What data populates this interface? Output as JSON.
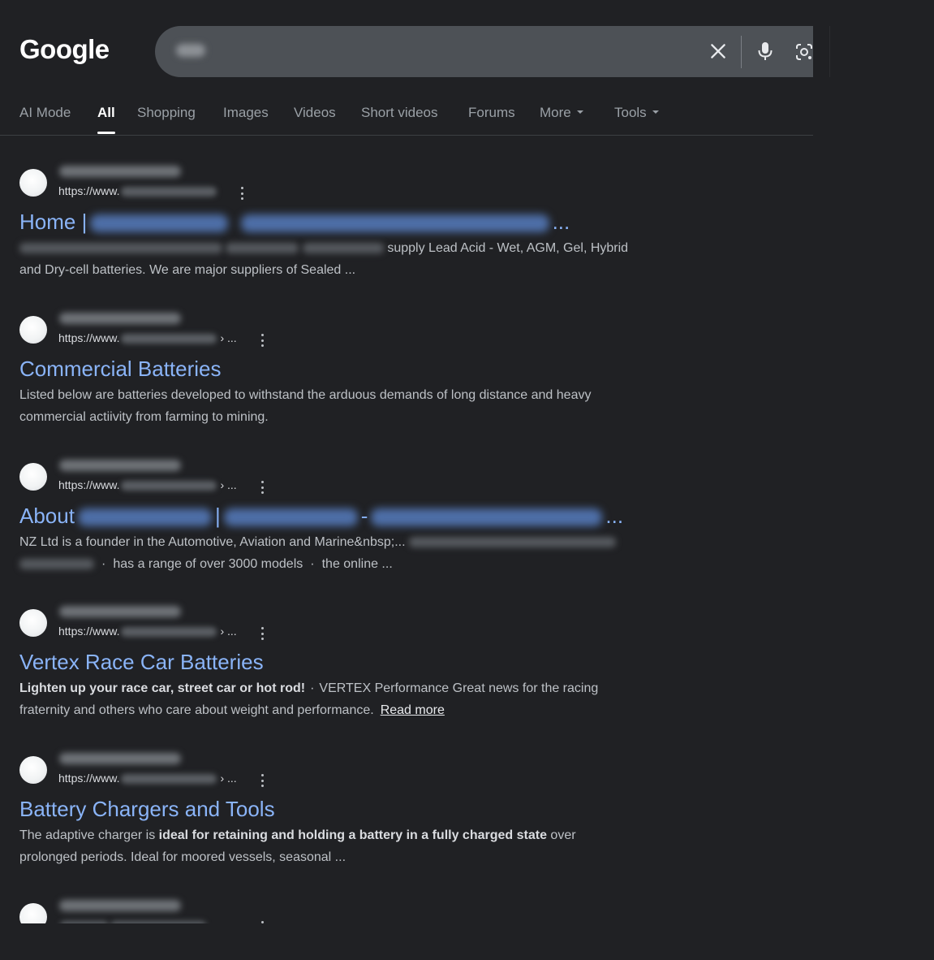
{
  "header": {
    "logo_text": "Google",
    "icons": {
      "clear": "close-icon",
      "voice": "mic-icon",
      "lens": "camera-lens-icon"
    }
  },
  "tabs": [
    {
      "label": "AI Mode"
    },
    {
      "label": "All",
      "active": true
    },
    {
      "label": "Shopping"
    },
    {
      "label": "Images"
    },
    {
      "label": "Videos"
    },
    {
      "label": "Short videos"
    },
    {
      "label": "Forums"
    },
    {
      "label": "More",
      "dropdown": true
    },
    {
      "label": "Tools",
      "dropdown": true
    }
  ],
  "results": [
    {
      "url_prefix": "https://www.",
      "url_tail": "",
      "title_start": "Home |",
      "title_end": "...",
      "snippet_line1": "supply Lead Acid - Wet, AGM, Gel, Hybrid",
      "snippet_line2": "and Dry-cell batteries. We are major suppliers of Sealed ..."
    },
    {
      "url_prefix": "https://www.",
      "url_tail": "› ...",
      "title": "Commercial Batteries",
      "snippet_line1": "Listed below are batteries developed to withstand the arduous demands of long distance and heavy",
      "snippet_line2": "commercial actiivity from farming to mining."
    },
    {
      "url_prefix": "https://www.",
      "url_tail": "› ...",
      "title_start": "About",
      "title_mid": "|",
      "title_dash": "-",
      "title_end": "...",
      "snippet_line1": "NZ Ltd is a founder in the Automotive, Aviation and Marine&nbsp;...",
      "snippet_part2": "has a range of over 3000 models",
      "snippet_part3": "the online ...",
      "separator": "·"
    },
    {
      "url_prefix": "https://www.",
      "url_tail": "› ...",
      "title": "Vertex Race Car Batteries",
      "snippet_bold": "Lighten up your race car, street car or hot rod!",
      "separator": "·",
      "snippet_line1_rest": "VERTEX Performance Great news for the racing",
      "snippet_line2": "fraternity and others who care about weight and performance.",
      "read_more": "Read more"
    },
    {
      "url_prefix": "https://www.",
      "url_tail": "› ...",
      "title": "Battery Chargers and Tools",
      "snippet_pre": "The adaptive charger is",
      "snippet_bold": "ideal for retaining and holding a battery in a fully charged state",
      "snippet_post": "over",
      "snippet_line2": "prolonged periods. Ideal for moored vessels, seasonal ..."
    }
  ],
  "colors": {
    "background": "#202124",
    "link": "#8ab4f8",
    "text": "#bdc1c6",
    "search_bar": "#4d5156"
  }
}
